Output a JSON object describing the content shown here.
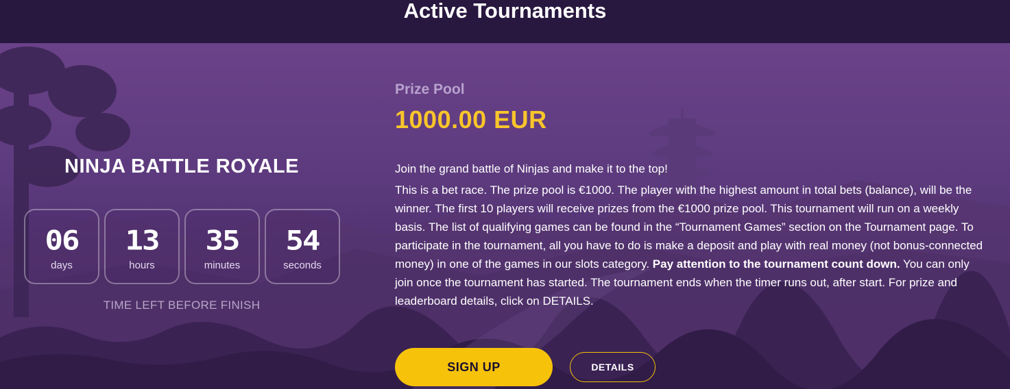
{
  "header": {
    "title": "Active Tournaments"
  },
  "tournament": {
    "name": "NINJA BATTLE ROYALE",
    "countdown": {
      "days": {
        "value": "06",
        "label": "days"
      },
      "hours": {
        "value": "13",
        "label": "hours"
      },
      "minutes": {
        "value": "35",
        "label": "minutes"
      },
      "seconds": {
        "value": "54",
        "label": "seconds"
      }
    },
    "time_left_label": "TIME LEFT BEFORE FINISH",
    "prize_pool_label": "Prize Pool",
    "prize_pool_amount": "1000.00 EUR",
    "intro": "Join the grand battle of Ninjas and make it to the top!",
    "description_part1": "This is a bet race. The prize pool is €1000. The player with the highest amount in total bets (balance), will be the winner. The first 10 players will receive prizes from the €1000 prize pool. This tournament will run on a weekly basis. The list of qualifying games can be found in the “Tournament Games” section on the Tournament page. To participate in the tournament, all you have to do is make a deposit and play with real money (not bonus-connected money) in one of the games in our slots category. ",
    "description_bold": "Pay attention to the tournament count down.",
    "description_part2": " You can only join once the tournament has started. The tournament ends when the timer runs out, after start. For prize and leaderboard details, click on DETAILS."
  },
  "buttons": {
    "signup_label": "SIGN UP",
    "details_label": "DETAILS"
  },
  "colors": {
    "accent_yellow": "#f7c20a",
    "prize_yellow": "#f8c52b",
    "header_bg": "#28173f",
    "hero_purple": "#5c3a7d"
  }
}
